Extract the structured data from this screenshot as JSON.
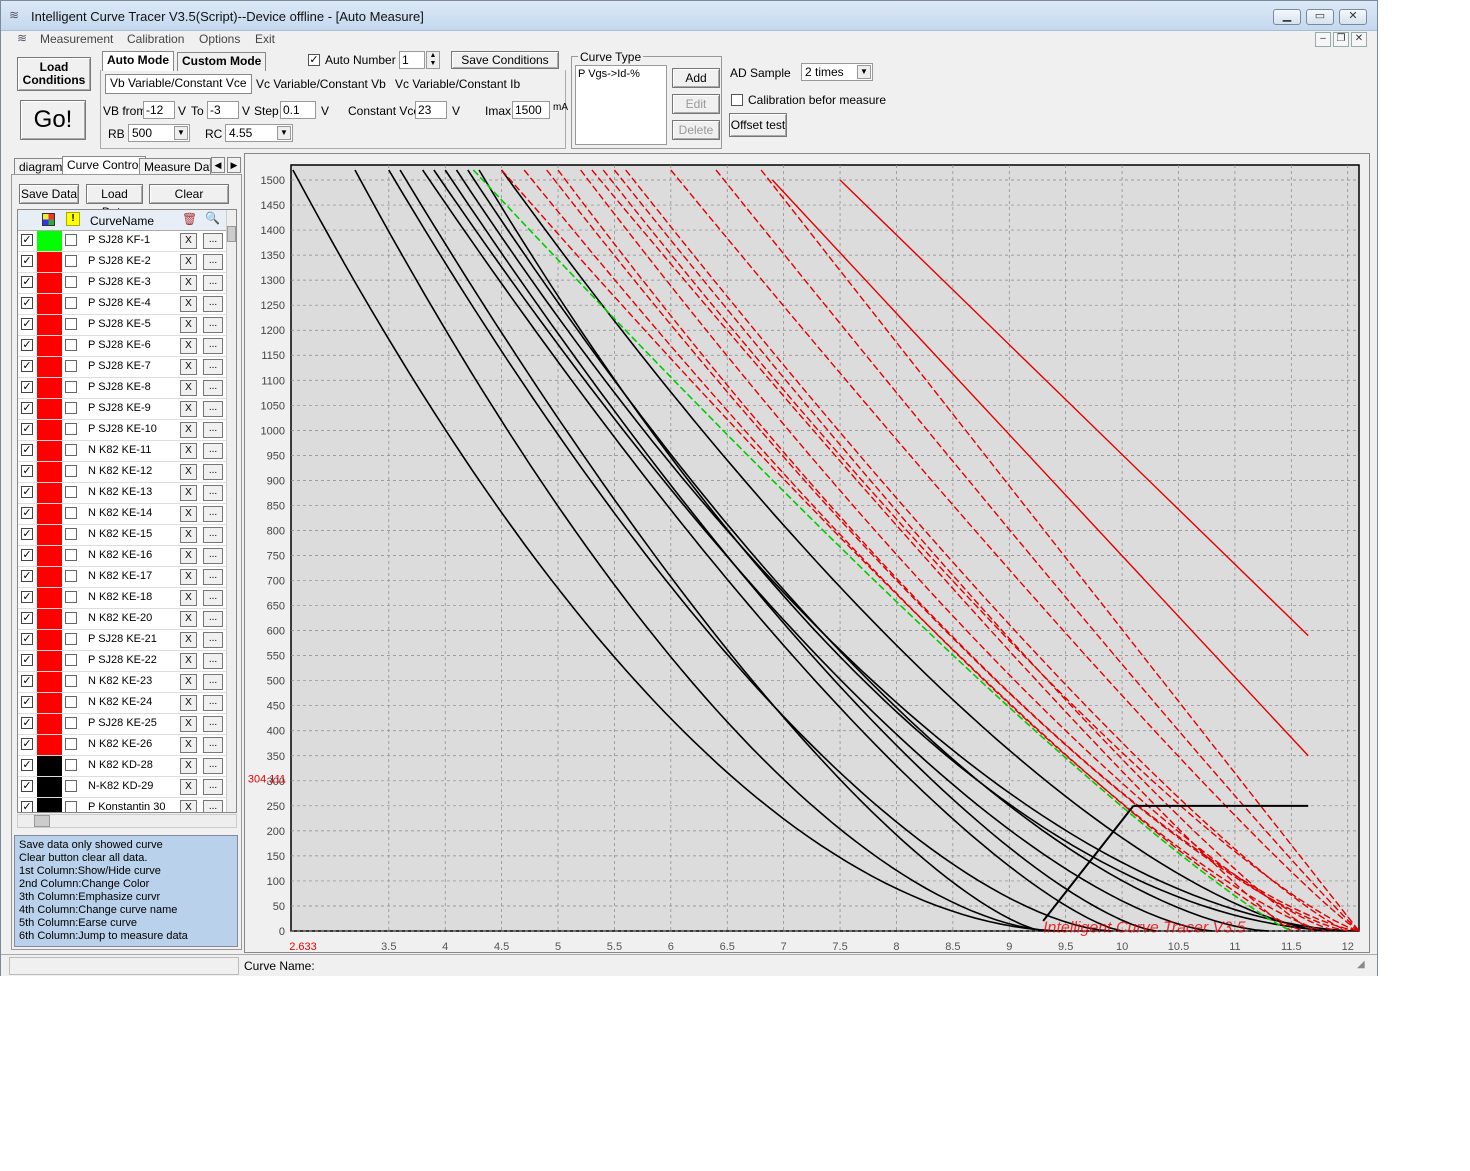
{
  "window": {
    "title": "Intelligent Curve Tracer V3.5(Script)--Device offline - [Auto Measure]"
  },
  "menu": [
    "Measurement",
    "Calibration",
    "Options",
    "Exit"
  ],
  "toolbar": {
    "load_conditions": "Load Conditions",
    "go": "Go!",
    "auto_mode": "Auto Mode",
    "custom_mode": "Custom Mode",
    "auto_number_label": "Auto Number",
    "auto_number_value": "1",
    "save_conditions": "Save Conditions",
    "subtabs": [
      "Vb Variable/Constant Vce",
      "Vc Variable/Constant Vb",
      "Vc Variable/Constant Ib"
    ],
    "vb_from_label": "VB from",
    "vb_from": "-12",
    "v1": "V",
    "to_label": "To",
    "to_value": "-3",
    "v2": "V",
    "step_label": "Step",
    "step_value": "0.1",
    "v3": "V",
    "const_vce_label": "Constant Vce",
    "const_vce": "23",
    "v4": "V",
    "imax_label": "Imax",
    "imax": "1500",
    "ma": "mA",
    "rb_label": "RB",
    "rb": "500",
    "rc_label": "RC",
    "rc": "4.55",
    "curve_type_label": "Curve Type",
    "curve_type_item": "P Vgs->Id-%",
    "add": "Add",
    "edit": "Edit",
    "delete": "Delete",
    "ad_sample_label": "AD Sample",
    "ad_sample": "2 times",
    "calibration_label": "Calibration befor measure",
    "offset_test": "Offset test"
  },
  "left": {
    "tabs": [
      "diagram",
      "Curve Control",
      "Measure Data"
    ],
    "save_data": "Save Data",
    "load_data": "Load Data",
    "clear": "Clear",
    "header_curvename": "CurveName",
    "rows": [
      {
        "name": "P SJ28 KF-1",
        "color": "#00ff00"
      },
      {
        "name": "P  SJ28 KE-2",
        "color": "#ff0000"
      },
      {
        "name": "P SJ28 KE-3",
        "color": "#ff0000"
      },
      {
        "name": "P SJ28 KE-4",
        "color": "#ff0000"
      },
      {
        "name": "P SJ28 KE-5",
        "color": "#ff0000"
      },
      {
        "name": "P SJ28 KE-6",
        "color": "#ff0000"
      },
      {
        "name": "P SJ28 KE-7",
        "color": "#ff0000"
      },
      {
        "name": "P SJ28 KE-8",
        "color": "#ff0000"
      },
      {
        "name": "P SJ28 KE-9",
        "color": "#ff0000"
      },
      {
        "name": "P SJ28 KE-10",
        "color": "#ff0000"
      },
      {
        "name": "N K82 KE-11",
        "color": "#ff0000"
      },
      {
        "name": "N K82 KE-12",
        "color": "#ff0000"
      },
      {
        "name": "N  K82 KE-13",
        "color": "#ff0000"
      },
      {
        "name": "N K82 KE-14",
        "color": "#ff0000"
      },
      {
        "name": "N  K82 KE-15",
        "color": "#ff0000"
      },
      {
        "name": "N K82 KE-16",
        "color": "#ff0000"
      },
      {
        "name": "N K82 KE-17",
        "color": "#ff0000"
      },
      {
        "name": "N K82 KE-18",
        "color": "#ff0000"
      },
      {
        "name": "N  K82 KE-20",
        "color": "#ff0000"
      },
      {
        "name": "P SJ28 KE-21",
        "color": "#ff0000"
      },
      {
        "name": "P SJ28 KE-22",
        "color": "#ff0000"
      },
      {
        "name": "N K82 KE-23",
        "color": "#ff0000"
      },
      {
        "name": "N  K82 KE-24",
        "color": "#ff0000"
      },
      {
        "name": "P SJ28 KE-25",
        "color": "#ff0000"
      },
      {
        "name": "N  K82 KE-26",
        "color": "#ff0000"
      },
      {
        "name": "N K82 KD-28",
        "color": "#000000"
      },
      {
        "name": "N-K82 KD-29",
        "color": "#000000"
      },
      {
        "name": "P Konstantin 30",
        "color": "#000000"
      }
    ],
    "help": [
      "  Save data only showed curve",
      "  Clear button clear all data.",
      "1st Column:Show/Hide curve",
      "2nd Column:Change Color",
      "3th Column:Emphasize curvr",
      "4th Column:Change curve name",
      "5th Column:Earse curve",
      "6th Column:Jump to measure data"
    ]
  },
  "chart_data": {
    "type": "line",
    "xlim": [
      2.633,
      12.1
    ],
    "ylim": [
      0,
      1530
    ],
    "x_ticks": [
      "3.5",
      "4",
      "4.5",
      "5",
      "5.5",
      "6",
      "6.5",
      "7",
      "7.5",
      "8",
      "8.5",
      "9",
      "9.5",
      "10",
      "10.5",
      "11",
      "11.5",
      "12"
    ],
    "y_ticks": [
      "0",
      "50",
      "100",
      "150",
      "200",
      "250",
      "300",
      "350",
      "400",
      "450",
      "500",
      "550",
      "600",
      "650",
      "700",
      "750",
      "800",
      "850",
      "900",
      "950",
      "1000",
      "1050",
      "1100",
      "1150",
      "1200",
      "1250",
      "1300",
      "1350",
      "1400",
      "1450",
      "1500"
    ],
    "x_min_label": "2.633",
    "cursor_label": "304.111",
    "cursor_y": 304.111,
    "watermark": "Intelligent Curve Tracer V3.5",
    "series_colors": [
      "#ff0000",
      "#000000",
      "#00cc00"
    ]
  },
  "status": {
    "curve_name_label": "Curve Name:"
  }
}
